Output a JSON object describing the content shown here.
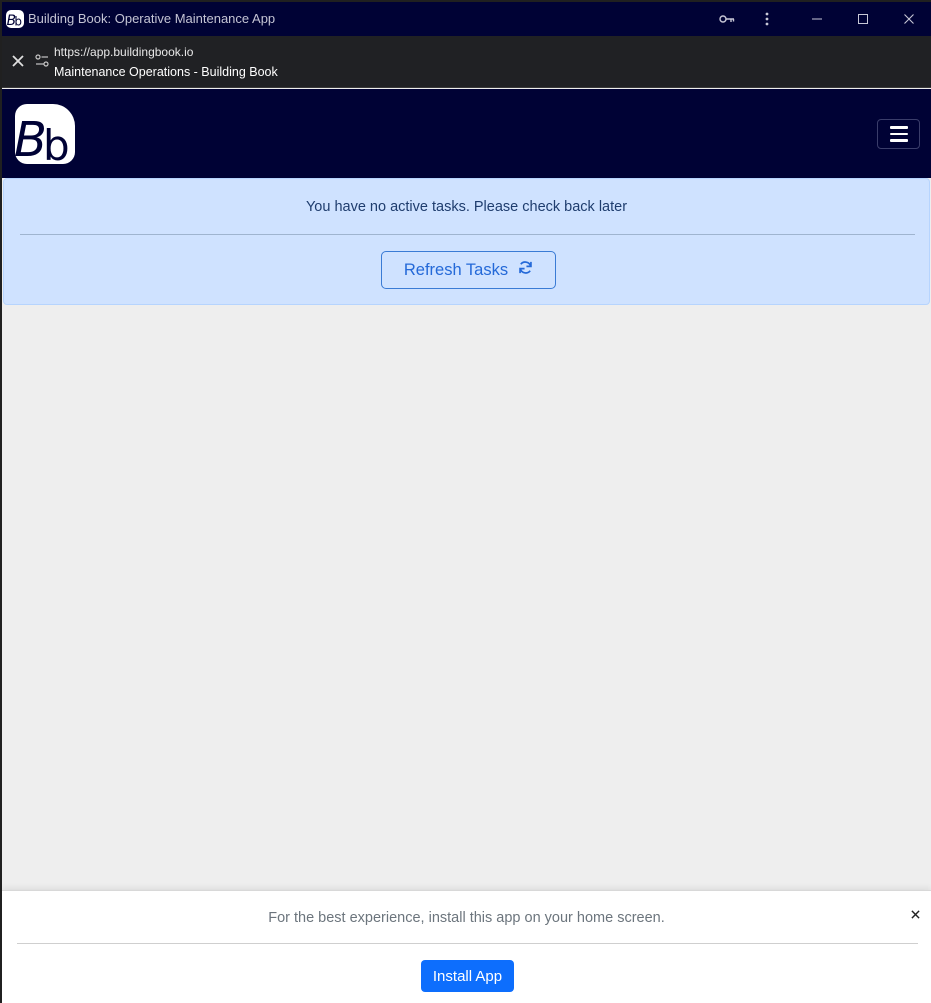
{
  "window": {
    "title": "Building Book: Operative Maintenance App",
    "icon": "building-book-logo"
  },
  "address_bar": {
    "url": "https://app.buildingbook.io",
    "page_title": "Maintenance Operations - Building Book"
  },
  "header": {
    "logo_text": "Bb",
    "menu_icon": "hamburger-menu-icon",
    "colors": {
      "background": "#000235"
    }
  },
  "alert": {
    "message": "You have no active tasks. Please check back later",
    "refresh_label": "Refresh Tasks",
    "refresh_icon": "refresh-icon",
    "colors": {
      "background": "#cfe2ff",
      "button": "#2469d8"
    }
  },
  "install_banner": {
    "message": "For the best experience, install this app on your home screen.",
    "button_label": "Install App",
    "colors": {
      "button": "#0d6efd"
    }
  }
}
